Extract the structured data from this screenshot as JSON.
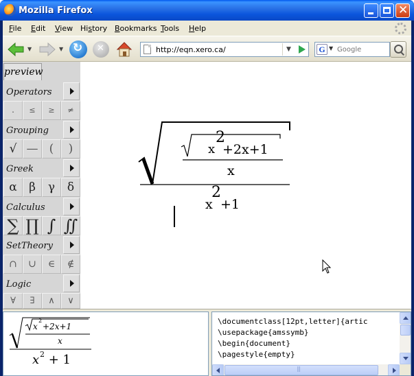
{
  "window": {
    "title": "Mozilla Firefox"
  },
  "menu": {
    "file": {
      "underline": "F",
      "rest": "ile"
    },
    "edit": {
      "underline": "E",
      "rest": "dit"
    },
    "view": {
      "underline": "V",
      "rest": "iew"
    },
    "history": {
      "pre": "Hi",
      "underline": "s",
      "rest": "tory"
    },
    "bookmarks": {
      "underline": "B",
      "rest": "ookmarks"
    },
    "tools": {
      "underline": "T",
      "rest": "ools"
    },
    "help": {
      "underline": "H",
      "rest": "elp"
    }
  },
  "navbar": {
    "url": "http://eqn.xero.ca/",
    "search_engine": "G",
    "search_placeholder": "Google"
  },
  "palette": {
    "preview_tab": "preview",
    "groups": [
      {
        "title": "Operators",
        "symbols": [
          ".",
          "≤",
          "≥",
          "≠"
        ]
      },
      {
        "title": "Grouping",
        "symbols": [
          "√",
          "—",
          "(",
          ")"
        ]
      },
      {
        "title": "Greek",
        "symbols": [
          "α",
          "β",
          "γ",
          "δ"
        ]
      },
      {
        "title": "Calculus",
        "symbols": [
          "∑",
          "∏",
          "∫",
          "∬"
        ]
      },
      {
        "title": "SetTheory",
        "symbols": [
          "∩",
          "∪",
          "∈",
          "∉"
        ]
      },
      {
        "title": "Logic",
        "symbols": [
          "∀",
          "∃",
          "∧",
          "∨"
        ]
      }
    ]
  },
  "editor": {
    "inner_var": "x",
    "inner_exp": "2",
    "inner_rest": "+2x+1",
    "inner_denominator": "x",
    "outer_var": "x",
    "outer_exp": "2",
    "outer_rest": "+1"
  },
  "preview": {
    "inner_num_var": "x",
    "inner_num_exp": "2",
    "inner_num_rest": "+2x+1",
    "inner_den": "x",
    "outer_den_var": "x",
    "outer_den_exp": "2",
    "outer_den_rest": " + 1"
  },
  "source": {
    "lines": [
      "\\documentclass[12pt,letter]{artic",
      "\\usepackage{amssymb}",
      "\\begin{document}",
      "\\pagestyle{empty}"
    ]
  }
}
